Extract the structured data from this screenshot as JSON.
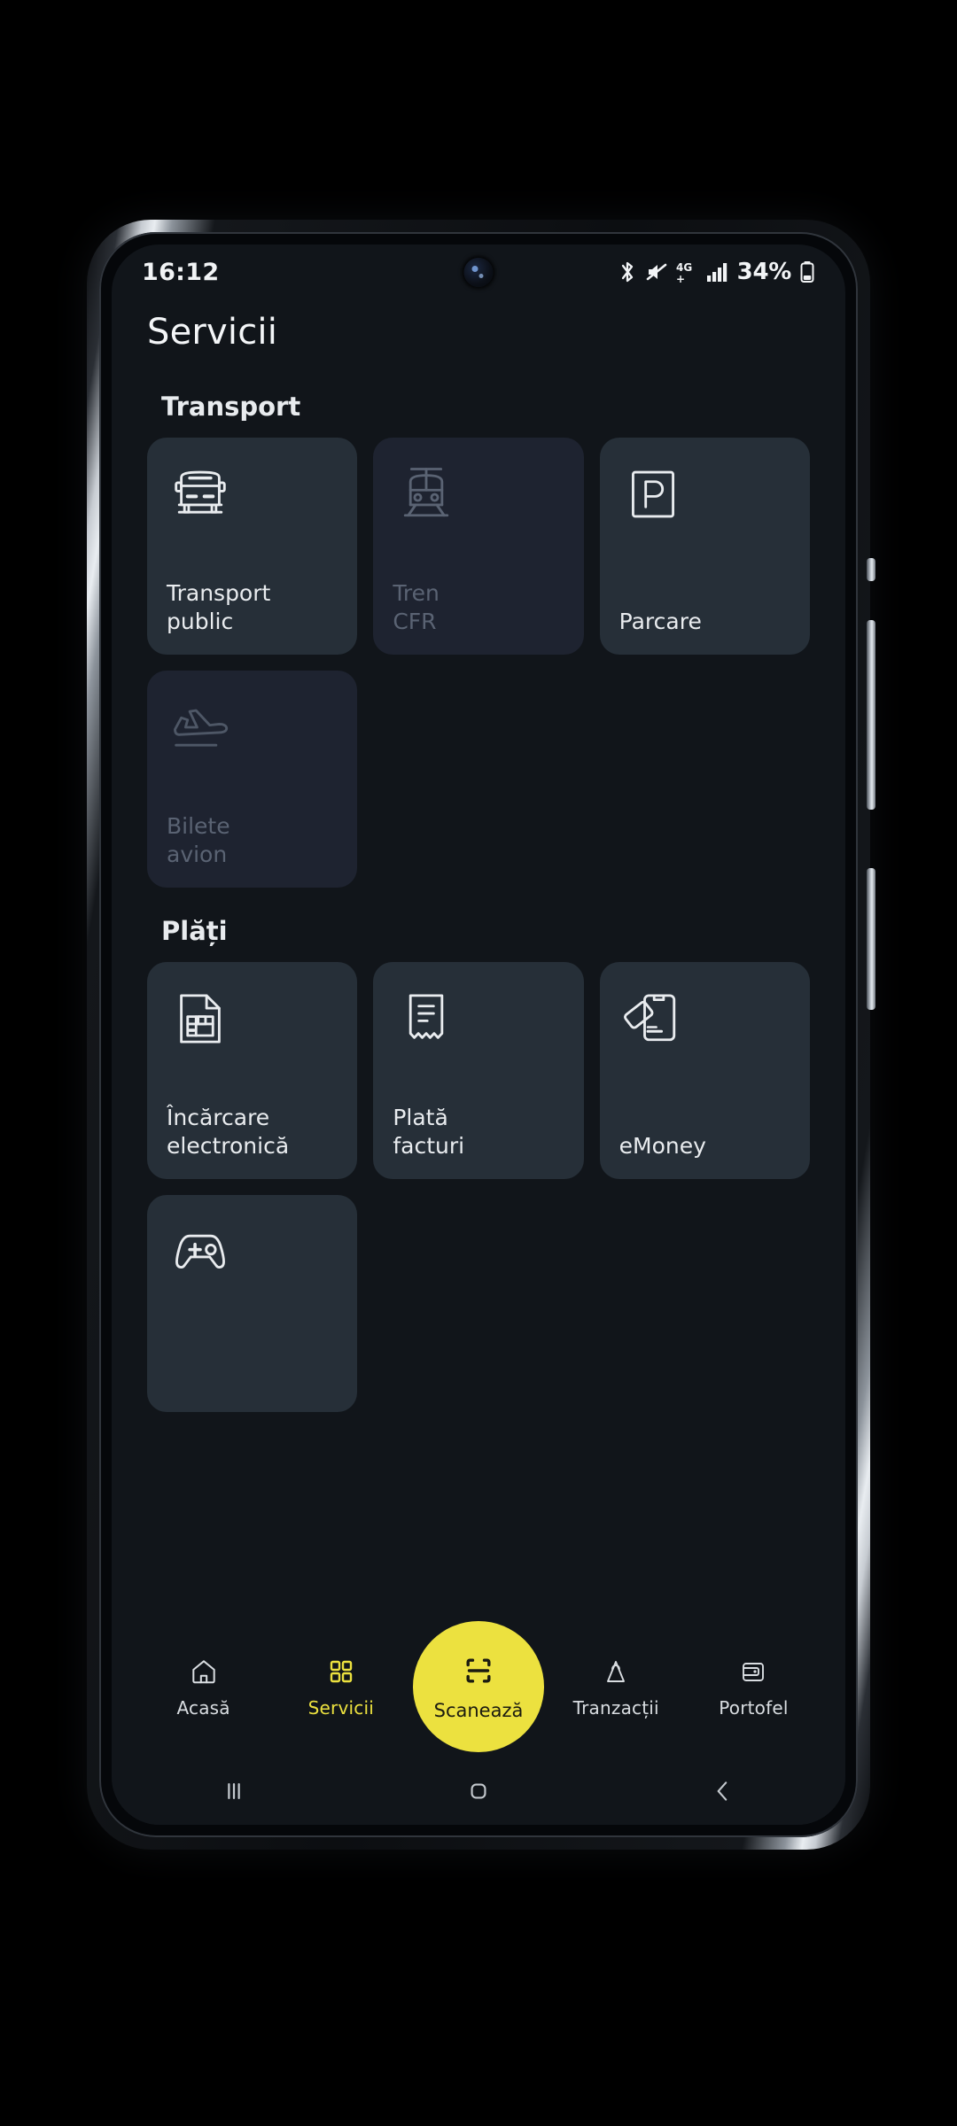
{
  "status_bar": {
    "time": "16:12",
    "battery_percent": "34%",
    "network": "4G+",
    "icons": [
      "bluetooth-icon",
      "mute-icon",
      "network-4g-plus-icon",
      "signal-bars-icon",
      "battery-icon"
    ]
  },
  "header": {
    "title": "Servicii"
  },
  "sections": [
    {
      "title": "Transport",
      "cards": [
        {
          "label": "Transport\npublic",
          "icon": "bus-icon",
          "disabled": false
        },
        {
          "label": "Tren\nCFR",
          "icon": "train-icon",
          "disabled": true
        },
        {
          "label": "Parcare",
          "icon": "parking-icon",
          "disabled": false
        },
        {
          "label": "Bilete\navion",
          "icon": "airplane-takeoff-icon",
          "disabled": true
        }
      ]
    },
    {
      "title": "Plăți",
      "cards": [
        {
          "label": "Încărcare\nelectronică",
          "icon": "sim-card-icon",
          "disabled": false
        },
        {
          "label": "Plată\nfacturi",
          "icon": "receipt-icon",
          "disabled": false
        },
        {
          "label": "eMoney",
          "icon": "phone-card-icon",
          "disabled": false
        },
        {
          "label": "",
          "icon": "gamepad-icon",
          "disabled": false
        }
      ]
    }
  ],
  "bottom_nav": {
    "items": [
      {
        "label": "Acasă",
        "icon": "home-icon",
        "active": false
      },
      {
        "label": "Servicii",
        "icon": "grid-icon",
        "active": true
      },
      {
        "label": "Scanează",
        "icon": "scan-icon",
        "active": false,
        "fab": true
      },
      {
        "label": "Tranzacții",
        "icon": "shopping-bag-icon",
        "active": false
      },
      {
        "label": "Portofel",
        "icon": "wallet-icon",
        "active": false
      }
    ]
  },
  "android_nav": {
    "items": [
      "recents-icon",
      "home-square-icon",
      "back-chevron-icon"
    ]
  },
  "colors": {
    "accent": "#ece13f",
    "screen_bg": "#11151a",
    "card_bg": "#262f38",
    "card_bg_disabled": "#1e2330",
    "text": "#e9ecef",
    "text_disabled": "#5a6373"
  }
}
